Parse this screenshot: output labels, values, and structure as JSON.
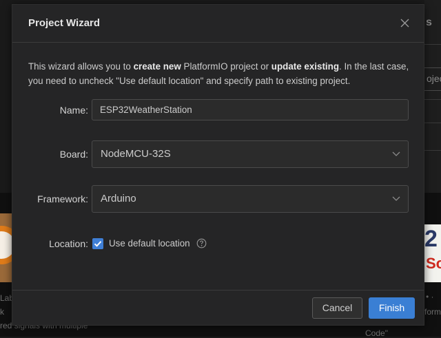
{
  "background": {
    "right_panel_letter": "s",
    "right_input_fragment": "ojec",
    "thumb_right_number": "2",
    "thumb_right_word": "So",
    "snippets": [
      {
        "text": "Lab"
      },
      {
        "text": "k"
      },
      {
        "text": "red signals with multiple"
      },
      {
        "text": "• ·"
      },
      {
        "text": "form"
      },
      {
        "text": "Code\""
      }
    ]
  },
  "modal": {
    "title": "Project Wizard",
    "close_icon": "close-icon",
    "intro": {
      "part1": "This wizard allows you to ",
      "bold1": "create new",
      "part2": " PlatformIO project or ",
      "bold2": "update existing",
      "part3": ". In the last case, you need to uncheck \"Use default location\" and specify path to existing project."
    },
    "form": {
      "name_label": "Name:",
      "name_value": "ESP32WeatherStation",
      "board_label": "Board:",
      "board_value": "NodeMCU-32S",
      "framework_label": "Framework:",
      "framework_value": "Arduino",
      "location_label": "Location:",
      "use_default_label": "Use default location",
      "use_default_checked": true
    },
    "buttons": {
      "cancel": "Cancel",
      "finish": "Finish"
    }
  },
  "colors": {
    "accent": "#3a7fd4",
    "modal_bg": "#252526",
    "backdrop": "#1a1a1a"
  }
}
